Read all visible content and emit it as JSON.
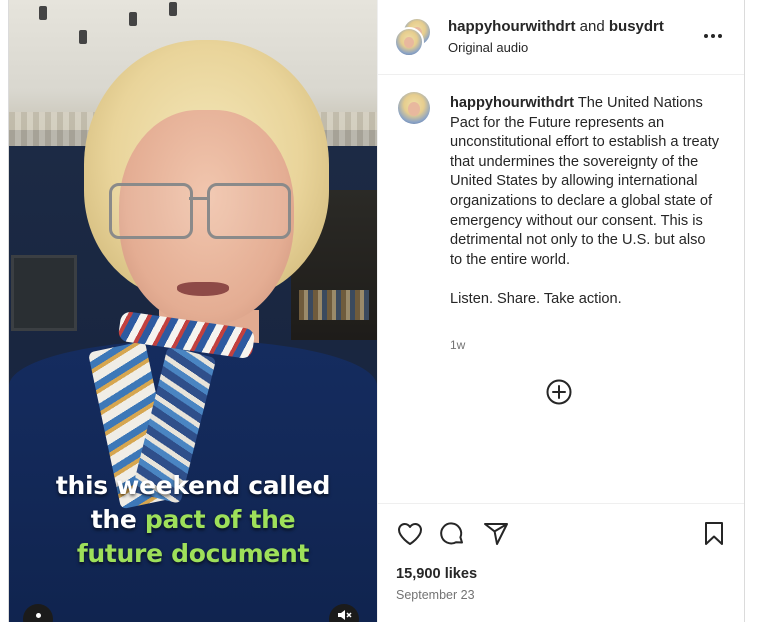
{
  "video": {
    "caption_line1": "this weekend called",
    "caption_line2_white": "the",
    "caption_line2_green": "pact of the",
    "caption_line3": "future document",
    "mute_icon": "speaker-muted-icon",
    "info_icon": "dot-icon"
  },
  "header": {
    "user1": "happyhourwithdrt",
    "joiner": "and",
    "user2": "busydrt",
    "audio": "Original audio",
    "more_icon": "more-horizontal-icon"
  },
  "post": {
    "username": "happyhourwithdrt",
    "caption": "The United Nations Pact for the Future represents an unconstitutional effort to establish a treaty that undermines the sovereignty of the United States by allowing international organizations to declare a global state of emergency without our consent. This is detrimental not only to the U.S. but also to the entire world.",
    "cta": "Listen. Share. Take action.",
    "time": "1w"
  },
  "actions": {
    "likes": "15,900 likes",
    "date": "September 23",
    "icons": [
      "heart-icon",
      "comment-icon",
      "share-icon",
      "bookmark-icon",
      "add-comment-icon"
    ]
  },
  "colors": {
    "caption_green": "#9ee05a",
    "text": "#262626",
    "muted": "#737373",
    "border": "#dbdbdb"
  }
}
